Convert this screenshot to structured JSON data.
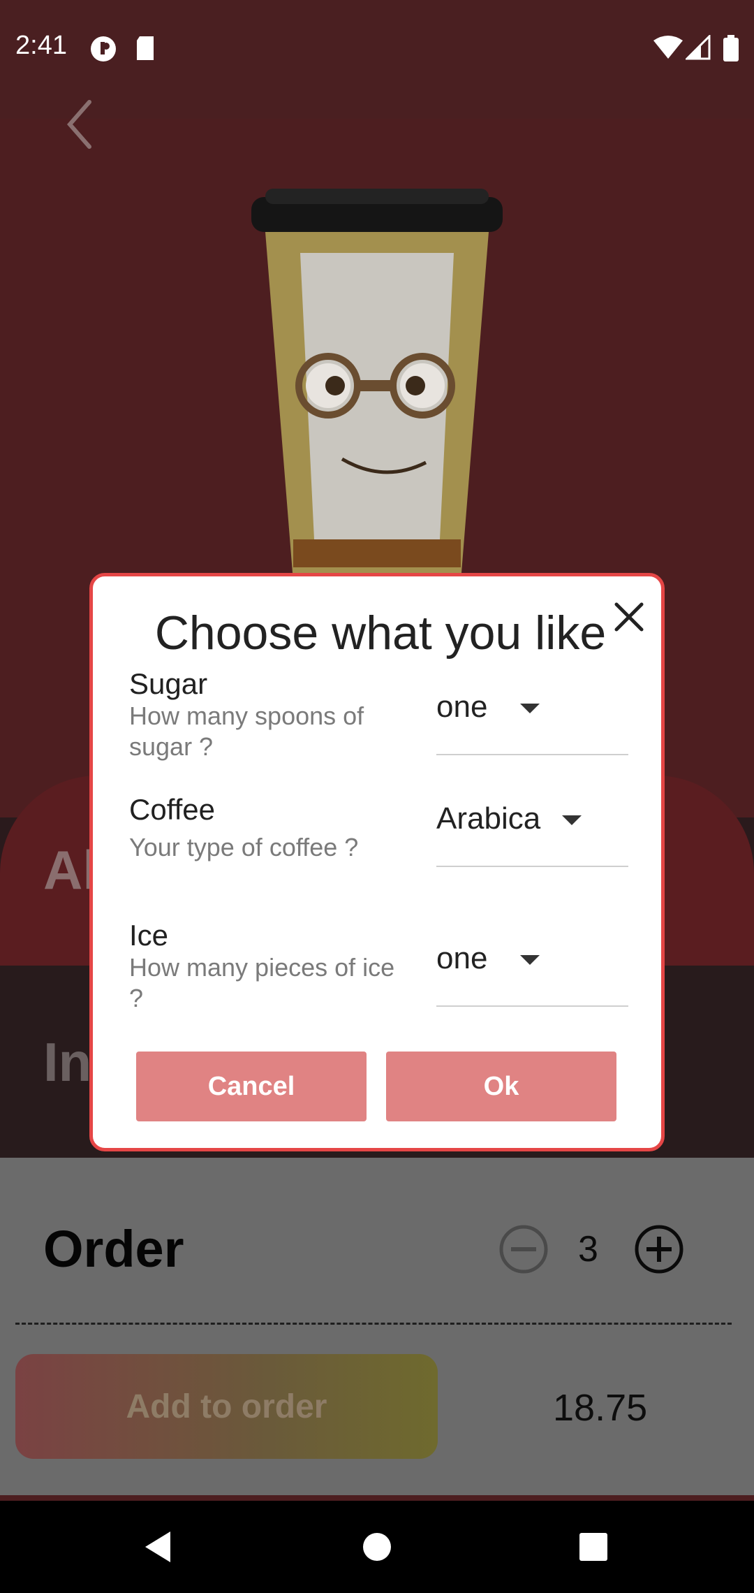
{
  "status_bar": {
    "time": "2:41",
    "left_icons": [
      "app-notification-icon",
      "sd-card-icon"
    ],
    "right_icons": [
      "wifi-icon",
      "signal-icon",
      "battery-icon"
    ]
  },
  "background": {
    "title_partial": "Al",
    "ingredients_partial": "In"
  },
  "order": {
    "title": "Order",
    "quantity": "3",
    "add_button": "Add to order",
    "price": "18.75"
  },
  "dialog": {
    "title": "Choose what you like",
    "options": [
      {
        "label": "Sugar",
        "description": "How many spoons of sugar ?",
        "value": "one"
      },
      {
        "label": "Coffee",
        "description": "Your type of coffee ?",
        "value": "Arabica"
      },
      {
        "label": "Ice",
        "description": "How many pieces of ice ?",
        "value": "one"
      }
    ],
    "cancel_label": "Cancel",
    "ok_label": "Ok"
  },
  "colors": {
    "accent": "#e54646",
    "button": "#e08383"
  }
}
